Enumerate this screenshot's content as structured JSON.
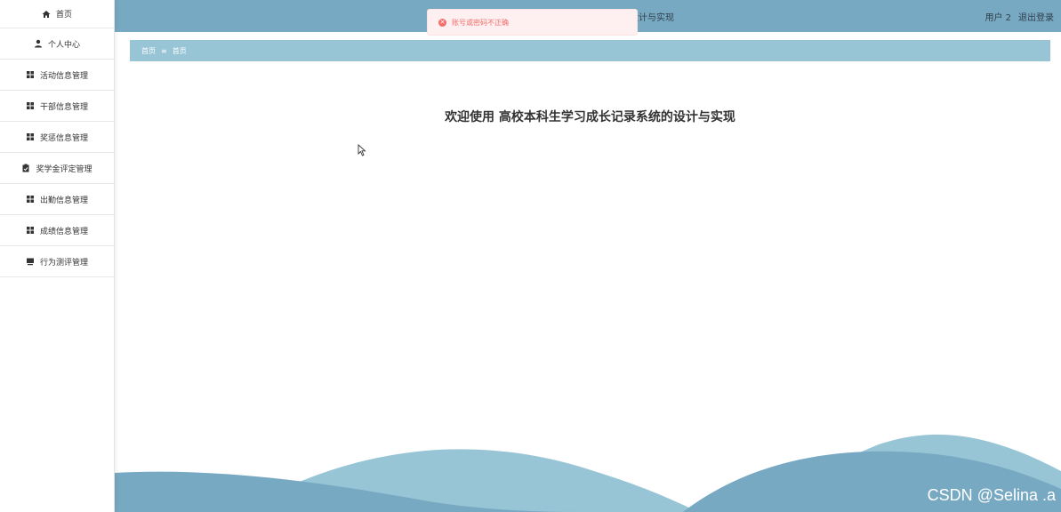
{
  "sidebar": {
    "items": [
      {
        "label": "首页",
        "icon": "home-icon"
      },
      {
        "label": "个人中心",
        "icon": "user-icon"
      },
      {
        "label": "活动信息管理",
        "icon": "grid-icon"
      },
      {
        "label": "干部信息管理",
        "icon": "grid-icon"
      },
      {
        "label": "奖惩信息管理",
        "icon": "grid-icon"
      },
      {
        "label": "奖学金评定管理",
        "icon": "clipboard-icon"
      },
      {
        "label": "出勤信息管理",
        "icon": "grid-icon"
      },
      {
        "label": "成绩信息管理",
        "icon": "grid-icon"
      },
      {
        "label": "行为测评管理",
        "icon": "monitor-icon"
      }
    ]
  },
  "header": {
    "title_fragment": "设计与实现",
    "user": "用户 2",
    "logout": "退出登录"
  },
  "alert": {
    "message": "账号或密码不正确",
    "type": "error"
  },
  "breadcrumb": {
    "items": [
      "首页",
      "首页"
    ],
    "separator": "≡"
  },
  "main": {
    "welcome": "欢迎使用 高校本科生学习成长记录系统的设计与实现"
  },
  "watermark": "CSDN @Selina .a",
  "colors": {
    "topbar": "#78a9c3",
    "breadcrumb": "#98c5d6",
    "wave_light": "#98c5d6",
    "wave_dark": "#78a9c3",
    "alert_text": "#f56c6c"
  }
}
